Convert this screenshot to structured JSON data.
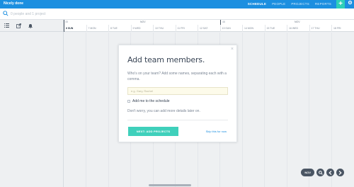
{
  "app": {
    "title": "Nicely done"
  },
  "nav": {
    "items": [
      {
        "label": "SCHEDULE",
        "active": true
      },
      {
        "label": "PEOPLE",
        "active": false
      },
      {
        "label": "PROJECTS",
        "active": false
      },
      {
        "label": "REPORTS",
        "active": false
      }
    ],
    "add_label": "+",
    "settings_icon": "gear-icon",
    "accent_color": "#1c8fe0",
    "add_color": "#2ecfb8"
  },
  "search": {
    "placeholder": "0 people and 1 project",
    "value": ""
  },
  "sidebar": {
    "tools": [
      "list-icon",
      "export-icon",
      "bell-icon"
    ]
  },
  "calendar": {
    "weeks": [
      {
        "label": "45"
      },
      {
        "label": "46"
      }
    ],
    "months": [
      {
        "label": "NOV"
      },
      {
        "label": "NOV"
      }
    ],
    "days": [
      {
        "label": "6 SUN",
        "today": true
      },
      {
        "label": "7 MON",
        "today": false
      },
      {
        "label": "8 TUE",
        "today": false
      },
      {
        "label": "9 WED",
        "today": false
      },
      {
        "label": "10 THU",
        "today": false
      },
      {
        "label": "11 FRI",
        "today": false
      },
      {
        "label": "12 SAT",
        "today": false
      },
      {
        "label": "13 SUN",
        "today": false
      },
      {
        "label": "14 MON",
        "today": false
      },
      {
        "label": "15 TUE",
        "today": false
      },
      {
        "label": "16 WED",
        "today": false
      },
      {
        "label": "17 THU",
        "today": false
      },
      {
        "label": "18 FRI",
        "today": false
      }
    ]
  },
  "controls": {
    "month_label": "NOV"
  },
  "modal": {
    "close_label": "×",
    "title": "Add team members.",
    "description": "Who's on your team? Add some names, separating each with a comma.",
    "input_placeholder": "e.g. Gary, Rachel",
    "input_value": "",
    "checkbox_label": "Add me to the schedule",
    "checkbox_checked": false,
    "note": "Don't worry, you can add more details later on.",
    "primary_button": "NEXT: ADD PROJECTS",
    "skip_link": "Skip this for now",
    "button_color": "#3fd0bb"
  }
}
